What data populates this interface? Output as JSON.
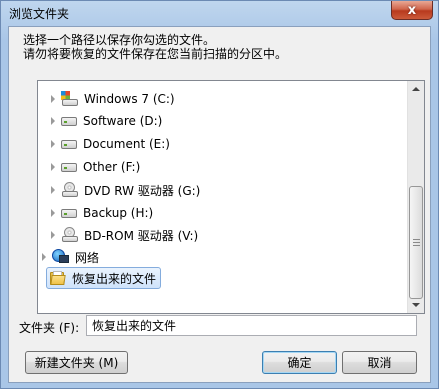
{
  "window": {
    "title": "浏览文件夹",
    "close_label": "x"
  },
  "instructions": {
    "line1": "选择一个路径以保存你勾选的文件。",
    "line2": "请勿将要恢复的文件保存在您当前扫描的分区中。"
  },
  "tree": {
    "items": [
      {
        "label": "Windows 7 (C:)",
        "icon": "system-drive-icon"
      },
      {
        "label": "Software (D:)",
        "icon": "drive-icon"
      },
      {
        "label": "Document (E:)",
        "icon": "drive-icon"
      },
      {
        "label": "Other (F:)",
        "icon": "drive-icon"
      },
      {
        "label": "DVD RW 驱动器 (G:)",
        "icon": "dvd-drive-icon"
      },
      {
        "label": "Backup (H:)",
        "icon": "drive-icon"
      },
      {
        "label": "BD-ROM 驱动器 (V:)",
        "icon": "dvd-drive-icon"
      }
    ],
    "network_label": "网络",
    "selected_folder": "恢复出来的文件"
  },
  "folder_field": {
    "label": "文件夹 (F):",
    "value": "恢复出来的文件"
  },
  "buttons": {
    "new_folder": "新建文件夹 (M)",
    "ok": "确定",
    "cancel": "取消"
  },
  "colors": {
    "accent_selection": "#cfe3fb",
    "window_frame": "#a9c6e7",
    "close_button": "#c7472b"
  }
}
